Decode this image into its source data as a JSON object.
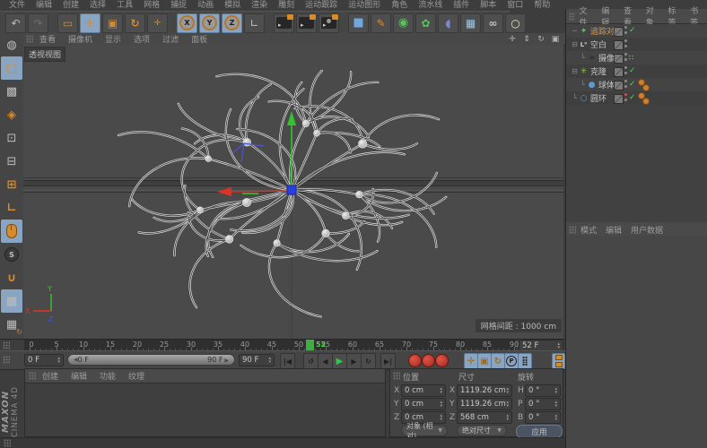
{
  "menubar": {
    "items": [
      "文件",
      "编辑",
      "创建",
      "选择",
      "工具",
      "网格",
      "捕捉",
      "动画",
      "模拟",
      "渲染",
      "雕刻",
      "运动跟踪",
      "运动图形",
      "角色",
      "流水线",
      "插件",
      "脚本",
      "窗口",
      "帮助"
    ]
  },
  "icons": {
    "undo": "↶",
    "redo": "↷",
    "select": "▭",
    "move": "✛",
    "scale": "▣",
    "rotate": "↻",
    "last_tool": "✛",
    "x": "X",
    "y": "Y",
    "z": "Z",
    "coord": "∟",
    "clap": "▸",
    "cube": "■",
    "pen": "✎",
    "subdiv": "◉",
    "mograph": "✿",
    "bend": "◖",
    "floor": "▦",
    "camera": "∞",
    "light": "○",
    "pan": "✛",
    "zoom_view": "⇕",
    "rotate_view": "↻",
    "maximize": "▣",
    "editable": "◍",
    "model": "▢",
    "texture": "▩",
    "workpaint": "◈",
    "points": "⊡",
    "edges": "⊟",
    "polys": "⊞",
    "axis": "∟",
    "snap": "S",
    "magnet": "∪",
    "grid": "▦",
    "goto_start": "|◀",
    "prev_key": "↺",
    "prev_frame": "◀",
    "play": "▶",
    "next_frame": "▶",
    "next_key": "↻",
    "goto_end": "▶|",
    "check": "✓",
    "target": "∷",
    "dropdown": "▼",
    "spin": "▴▾",
    "param": "P",
    "dots": "⣿",
    "tracer": "✦",
    "null": "L⁰",
    "camera_obj": "∞",
    "cloner": "✳",
    "sphere": "●",
    "circle": "○",
    "expander": "⊟",
    "branch": "└"
  },
  "viewport": {
    "menu": [
      "查看",
      "摄像机",
      "显示",
      "选项",
      "过滤",
      "面板"
    ],
    "view_label": "透视视图",
    "grid_label": "网格间距 : 1000 cm",
    "axis": {
      "x": "X",
      "y": "Y",
      "z": "Z"
    }
  },
  "object_manager": {
    "menu": [
      "文件",
      "编辑",
      "查看",
      "对象",
      "标签",
      "书签"
    ],
    "objects": [
      {
        "label": "追踪对象"
      },
      {
        "label": "空白"
      },
      {
        "label": "摄像机"
      },
      {
        "label": "克隆"
      },
      {
        "label": "球体"
      },
      {
        "label": "圆环"
      }
    ]
  },
  "attributes": {
    "menu": [
      "模式",
      "编辑",
      "用户数据"
    ]
  },
  "timeline": {
    "ticks": [
      0,
      5,
      10,
      15,
      20,
      25,
      30,
      35,
      40,
      45,
      50,
      55,
      60,
      65,
      70,
      75,
      80,
      85,
      90
    ],
    "current_frame": 52,
    "frame_field": "52 F"
  },
  "transport": {
    "start": "0 F",
    "range_start": "0 F",
    "range_end": "90 F",
    "end": "90 F"
  },
  "materials": {
    "menu": [
      "创建",
      "编辑",
      "功能",
      "纹理"
    ]
  },
  "coordinates": {
    "headers": [
      "位置",
      "尺寸",
      "旋转"
    ],
    "fields": {
      "px": {
        "label": "X",
        "value": "0 cm"
      },
      "py": {
        "label": "Y",
        "value": "0 cm"
      },
      "pz": {
        "label": "Z",
        "value": "0 cm"
      },
      "sx": {
        "label": "X",
        "value": "1119.26 cm"
      },
      "sy": {
        "label": "Y",
        "value": "1119.26 cm"
      },
      "sz": {
        "label": "Z",
        "value": "568 cm"
      },
      "rh": {
        "label": "H",
        "value": "0 °"
      },
      "rp": {
        "label": "P",
        "value": "0 °"
      },
      "rb": {
        "label": "B",
        "value": "0 °"
      }
    },
    "position_mode": "对象 (相对)",
    "size_mode": "绝对尺寸",
    "apply": "应用"
  },
  "branding": {
    "maxon": "MAXON",
    "cinema": "CINEMA 4D"
  },
  "colors": {
    "accent_orange": "#d98a2b",
    "highlight_blue": "#8aa5c2",
    "play_green": "#3fae3f",
    "record_red": "#c0392b",
    "selected_text": "#d79b4a",
    "viewport_bg": "#4a4a4a"
  }
}
